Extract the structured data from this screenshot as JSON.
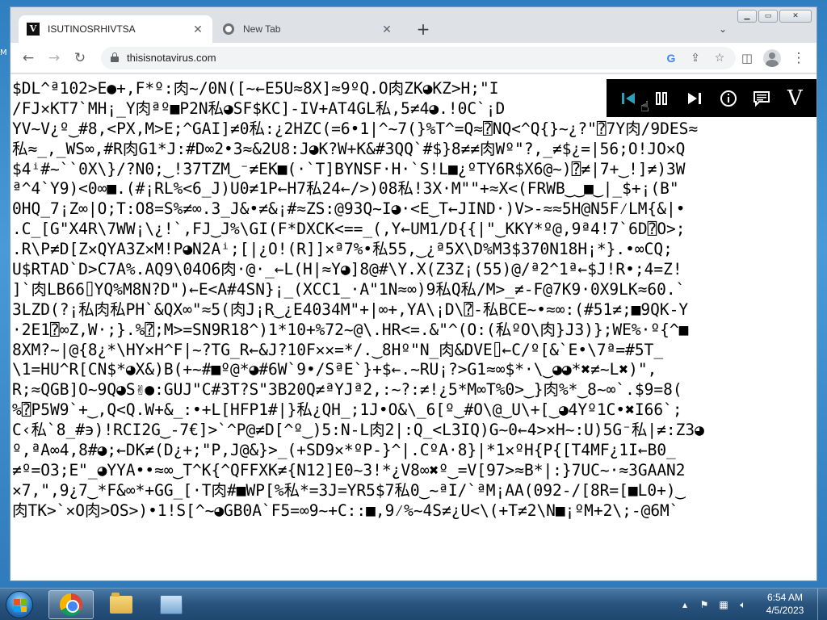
{
  "browser": {
    "tabs": [
      {
        "title": "ISUTINOSRHIVTSA",
        "favicon": "v-logo-icon",
        "active": true
      },
      {
        "title": "New Tab",
        "favicon": "chrome-icon",
        "active": false
      }
    ],
    "url": "thisisnotavirus.com"
  },
  "page": {
    "lines": [
      "$DL^ª102>E●+,F*º:肉~/0N([~←E5U≈8X]≈9ºQ.O肉ZK◕KZ>H;\"I",
      "/FJ✕KT7`MH¡_Y肉ªº■P2N私◕SF$KC]-IV+AT4GL私,5≠4◕.!0C`¡D",
      "YV~V¿º‿#8,<PX,M>E;^GAI]≠0私:¿2HZC(=6•1|^~7(}%T^=Q≈⍰NQ<^Q{}~¿?\"⍰7Y肉/9DES≈",
      "私≈_,_WS∞,#R肉G1*J:#D∞2•3≈&2U8:J◕K?W+K&#3QQ`#$}8≠≠肉Wº\"?,_≠$¿=|56;O!JO✕Q",
      "$4ⁱ#~``0X\\}/?N0;‿!37TZM‿⁻≠EK■(·`T]BYNSF·H·`S!L■¿ºTY6R$X6@~)⍰≠|7+‿!]≠)3W",
      "ª^4`Y9)<0∞■.(#¡RL%<6_J)U0≠1P←H7私24←/>)08私!3X·M\"\"+≈X<(FRWB‿‿■‿|_$+¡(B\"",
      "0HQ_7¡Z∞|O;T:O8=S%≠∞.3_J&•≠&¡#≈ZS:@93Q~I◕·<E‿T←JIND·)V>-≈≈5H@N5F⁄LM{&|•",
      ".C_[G\"X4R\\7WW¡\\¿!`,FJ‿J%\\GI(F*DXCK<==_(,Y←UM1/D{{|\"‿KKY*º@,9ª4!7`6D⍰O>;",
      ".R\\P≠D[Z✕QYA3Z✕M!P◕N2Aⁱ;[|¿O!(R]]✕ª7%•私55,‿¿ª5X\\D%M3$370N18H¡*}.•∞CQ;",
      "U$RTAD`D>C7A%.AQ9\\04O6肉·@·_←L(H|≈Y◕]8@#\\Y.X(Z3Z¡(55)@/ª2^1ª←$J!R•;4=Z!",
      "]`肉LB66⌷YQ%M8N?D\")←E<A#4SN}¡_(XCC1_·A\"1N≈∞)9私Q私/M>_≠-F@7K9·0X9LK≈60.`",
      "3LZD(?¡私肉私PH`&QX∞\"≈5(肉J¡R‿¿E4034M\"+|∞+,YA\\¡D\\⍰-私BCE~•≈∞:(#51≠;■9QK-Y",
      "·2E1⍰∞Z,W·;}.%⍰;M>=SN9R18^)1*10+%72~@\\.HR<=.&\"^(O:(私ºO\\肉}J3)};WE%·º{^■",
      "8XM?~|@{8¿*\\HY✕H^F|~?TG_R←&J?10F✕✕=*/.‿8Hº\"N_肉&DVE⌷←C/º[&`E•\\7ª=#5T_",
      "\\1=HU^R[CN$*◕X&)B(+~#■º@*◕#6W`9•/SªE`}+$←.~RU¡?>G1≈∞$*·\\‿◕◕*✖≠~L✖)\",",
      "R;≈QGB]O~9Q◕S✌●:GUJ\"C#3T?S\"3B20Q≠ªYJª2,:~?:≠!¿5*M∞T%0>‿}肉%*‿8~∞`.$9=8(",
      "%⍰P5W9`+‿,Q<Q.W+&_:•+L[HFP1#|}私¿QH_;1J•O&\\_6[º‿#O\\@‿U\\+[‿◕4Yº1C•✖I66`;",
      "C‹私`8_#϶)!RCI2G‿-7€]>`^P@≠D[^º‿)5:N-L肉2|:Q_<L3IQ)G~0←4>✕H~:U)5G⁻私|≠:Z3◕",
      "º,ªA∞4,8#◕;←DK≠(D¿+;\"P,J@&}>_(+SD9✕*ºP-}^|.CºA·8}|*1✕ºH{P{[T4MF¿1I←B0_",
      "≠º=O3;E\"_◕YYA••≈∞‿T^K{^QFFXK≠{N12]E0~3!*¿V8∞✖º‿=V[97>≈B*|:}7UC~·≈3GAAN2",
      "✕7,\",9¿7‿*F&∞*+GG_[·T肉#■WP[%私*=3J=YR5$7私0‿~ªI/`ªM¡AA(092-/[8R=[■L0+)‿",
      "肉TK>`✕O肉>OS>)•1!S[^~◕GB0A`F5=∞9~+C::■,9⁄%~4S≠¿U<\\(+T≠2\\N■¡ºM+2\\;-@6M`"
    ]
  },
  "taskbar": {
    "time": "6:54 AM",
    "date": "4/5/2023"
  },
  "colors": {
    "player_bg": "#000000",
    "player_active": "#2aa1b8",
    "tabstrip_bg": "#dee1e6"
  }
}
